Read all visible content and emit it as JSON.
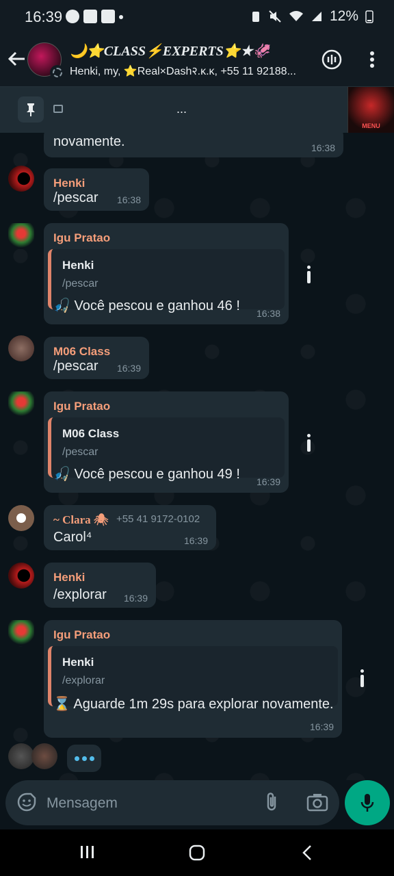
{
  "status_bar": {
    "time": "16:39",
    "battery_text": "12%"
  },
  "header": {
    "title": "🌙⭐CLASS⚡EXPERTS⭐★🦑",
    "members": "Henki, my, ⭐Real×Dash२.κ.κ, +55 11 92188..."
  },
  "pinned": {
    "preview_text": "...",
    "thumb_text": "MENU"
  },
  "messages": [
    {
      "type": "tail",
      "text": "novamente.",
      "time": "16:38"
    },
    {
      "sender": "Henki",
      "sender_color": "#f59e7a",
      "text": "/pescar",
      "time": "16:38"
    },
    {
      "sender": "Igu Pratao",
      "sender_color": "#f59e7a",
      "quote_name": "Henki",
      "quote_text": "/pescar",
      "text": "🎣 Você pescou e ganhou 46 !",
      "time": "16:38"
    },
    {
      "sender": "M06 Class",
      "sender_color": "#f59e7a",
      "text": "/pescar",
      "time": "16:39"
    },
    {
      "sender": "Igu Pratao",
      "sender_color": "#f59e7a",
      "quote_name": "M06 Class",
      "quote_text": "/pescar",
      "text": "🎣 Você pescou e ganhou 49 !",
      "time": "16:39"
    },
    {
      "sender": "~ Clara 🕷",
      "sender_color": "#f59e7a",
      "phone": "+55 41 9172-0102",
      "text": "Carol⁴",
      "time": "16:39"
    },
    {
      "sender": "Henki",
      "sender_color": "#f59e7a",
      "text": "/explorar",
      "time": "16:39"
    },
    {
      "sender": "Igu Pratao",
      "sender_color": "#f59e7a",
      "quote_name": "Henki",
      "quote_text": "/explorar",
      "text": "⌛ Aguarde 1m 29s para explorar novamente.",
      "time": "16:39"
    }
  ],
  "input": {
    "placeholder": "Mensagem"
  },
  "colors": {
    "accent": "#00a884",
    "sender": "#f59e7a",
    "quote_bar": "#e0846a"
  }
}
